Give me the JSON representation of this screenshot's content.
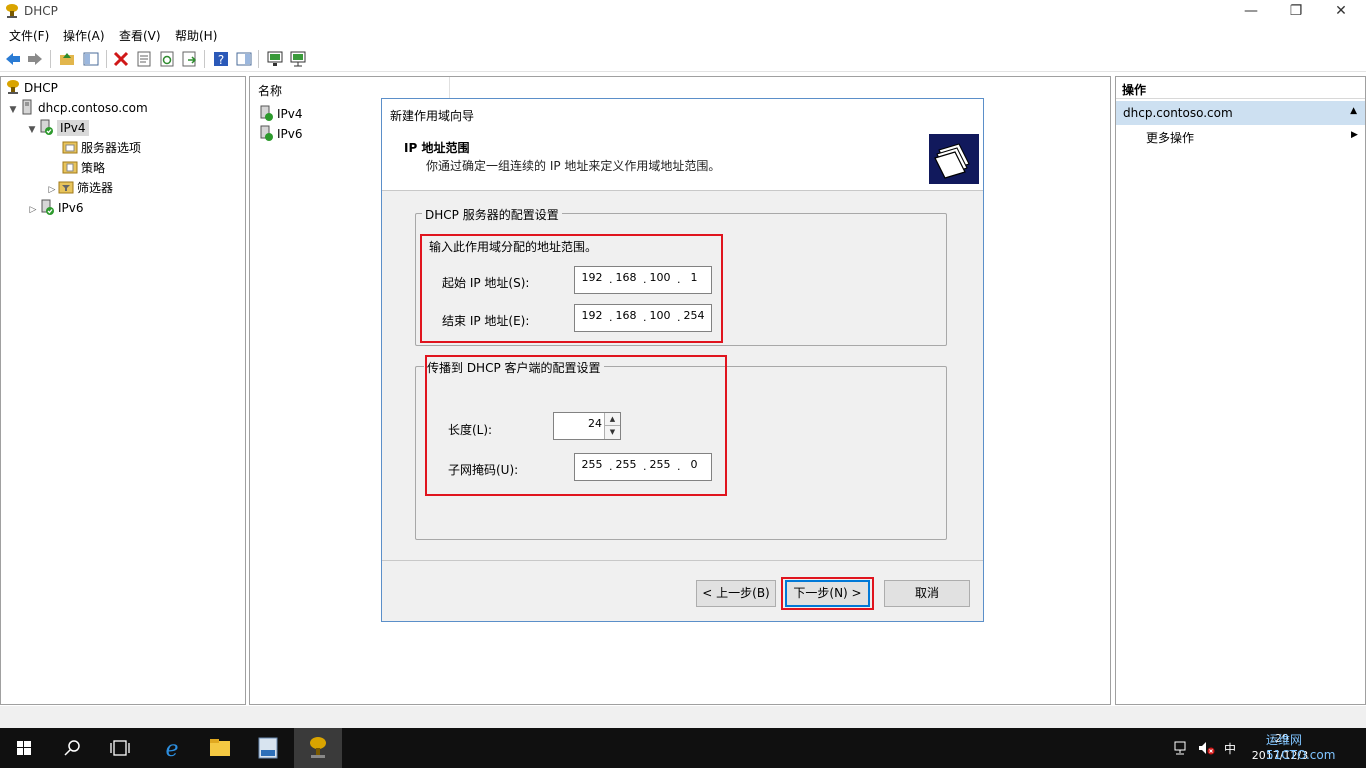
{
  "window": {
    "title": "DHCP",
    "minimize": "—",
    "restore": "❐",
    "close": "✕"
  },
  "menu": [
    "文件(F)",
    "操作(A)",
    "查看(V)",
    "帮助(H)"
  ],
  "tree": {
    "root": "DHCP",
    "server": "dhcp.contoso.com",
    "ipv4": "IPv4",
    "server_options": "服务器选项",
    "policies": "策略",
    "filters": "筛选器",
    "ipv6": "IPv6"
  },
  "list": {
    "column_name": "名称",
    "rows": [
      "IPv4",
      "IPv6"
    ]
  },
  "actions": {
    "title": "操作",
    "section": "dhcp.contoso.com",
    "more": "更多操作"
  },
  "wizard": {
    "caption": "新建作用域向导",
    "heading": "IP 地址范围",
    "description": "你通过确定一组连续的 IP 地址来定义作用域地址范围。",
    "server_group": "DHCP 服务器的配置设置",
    "range_prompt": "输入此作用域分配的地址范围。",
    "start_label": "起始 IP 地址(S):",
    "start_ip": [
      "192",
      "168",
      "100",
      "1"
    ],
    "end_label": "结束 IP 地址(E):",
    "end_ip": [
      "192",
      "168",
      "100",
      "254"
    ],
    "client_group": "传播到 DHCP 客户端的配置设置",
    "length_label": "长度(L):",
    "length_value": "24",
    "mask_label": "子网掩码(U):",
    "mask": [
      "255",
      "255",
      "255",
      "0"
    ],
    "back": "< 上一步(B)",
    "next": "下一步(N) >",
    "cancel": "取消"
  },
  "taskbar": {
    "ime": "中",
    "clock_time": ":29",
    "clock_date": "2017/12/3",
    "watermark": "运维网 51CTO.com"
  }
}
